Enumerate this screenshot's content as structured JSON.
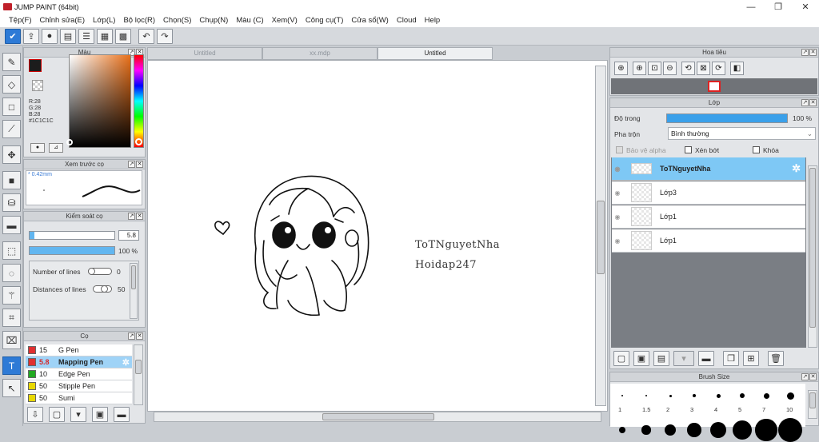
{
  "window": {
    "title": "JUMP PAINT (64bit)",
    "min": "—",
    "max": "❐",
    "close": "✕"
  },
  "menu": [
    "Tệp(F)",
    "Chỉnh sửa(E)",
    "Lớp(L)",
    "Bộ lọc(R)",
    "Chọn(S)",
    "Chụp(N)",
    "Màu (C)",
    "Xem(V)",
    "Công cụ(T)",
    "Cửa sổ(W)",
    "Cloud",
    "Help"
  ],
  "toolbar": {
    "icons": [
      "check-icon",
      "upload-icon",
      "comment-icon",
      "chat-icon",
      "page-icon",
      "list-icon",
      "grid-icon"
    ],
    "undo_icon": "undo-icon",
    "redo_icon": "redo-icon"
  },
  "color_panel": {
    "title": "Màu",
    "main_color": "#1C1C1C",
    "sub_color": "#F7A6A8",
    "r": "R:28",
    "g": "G:28",
    "b": "B:28",
    "hex": "#1C1C1C"
  },
  "preview_panel": {
    "title": "Xem trước cọ",
    "size": "* 0.42mm"
  },
  "brush_control": {
    "title": "Kiểm soát cọ",
    "size_value": "5.8",
    "size_fraction": 0.06,
    "opacity_value": "100 %",
    "opacity_fraction": 1.0,
    "lines_label": "Number of lines",
    "lines_value": "0",
    "distance_label": "Distances of lines",
    "distance_value": "50"
  },
  "brush_list": {
    "title": "Cọ",
    "items": [
      {
        "size": "15",
        "name": "G Pen",
        "color": "#e03030"
      },
      {
        "size": "5.8",
        "name": "Mapping Pen",
        "color": "#e03030"
      },
      {
        "size": "10",
        "name": "Edge Pen",
        "color": "#22aa22"
      },
      {
        "size": "50",
        "name": "Stipple Pen",
        "color": "#e8d800"
      },
      {
        "size": "50",
        "name": "Sumi",
        "color": "#e8d800"
      }
    ]
  },
  "tabs": [
    "Untitled",
    "xx.mdp",
    "Untitled"
  ],
  "canvas": {
    "text1": "ToTNguyetNha",
    "text2": "Hoidap247"
  },
  "navigator": {
    "title": "Hoa tiêu"
  },
  "layers": {
    "title": "Lớp",
    "opacity_label": "Độ trong",
    "opacity_value": "100 %",
    "opacity_fraction": 1.0,
    "blend_label": "Pha trộn",
    "blend_value": "Bình thường",
    "protect_alpha": "Bảo vệ alpha",
    "clipping": "Xén bớt",
    "lock": "Khóa",
    "items": [
      "ToTNguyetNha",
      "Lớp3",
      "Lớp1",
      "Lớp1"
    ]
  },
  "brush_size": {
    "title": "Brush Size",
    "labels": [
      "1",
      "1.5",
      "2",
      "3",
      "4",
      "5",
      "7",
      "10"
    ]
  }
}
